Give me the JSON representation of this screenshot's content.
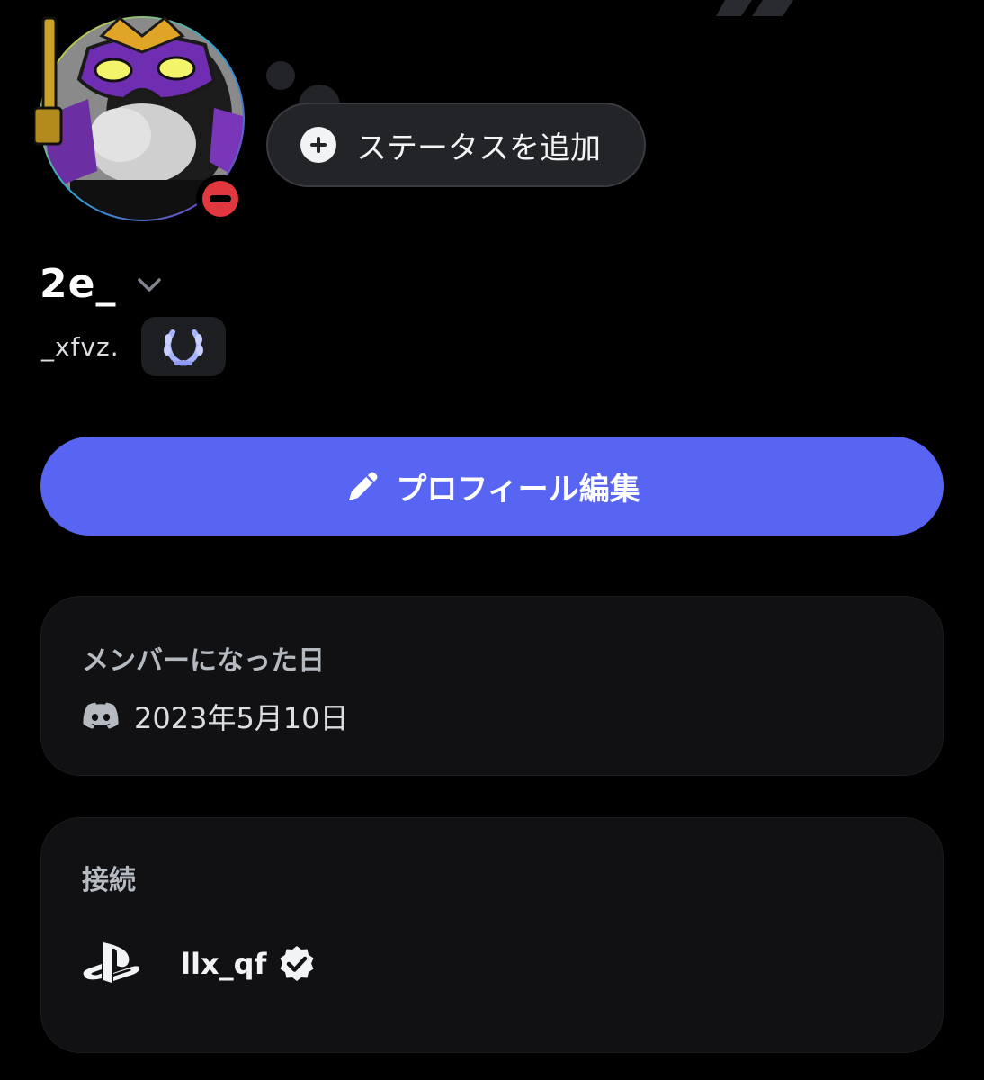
{
  "profile": {
    "display_name": "2e_",
    "username": "_xfvz.",
    "status_button_label": "ステータスを追加",
    "edit_button_label": "プロフィール編集"
  },
  "member_since": {
    "title": "メンバーになった日",
    "date": "2023年5月10日"
  },
  "connections": {
    "title": "接続",
    "items": [
      {
        "service_icon": "playstation-icon",
        "name": "llx_qf",
        "verified": true
      }
    ]
  },
  "colors": {
    "background": "#000000",
    "card": "#111114",
    "accent": "#5865f2",
    "dnd_status": "#e0383e"
  },
  "icons": {
    "status_indicator": "do-not-disturb-icon",
    "add_status": "plus-circle-icon",
    "expand": "chevron-down-icon",
    "badge": "laurel-badge-icon",
    "edit": "pencil-icon",
    "member_since": "discord-logo-icon",
    "verified": "verified-check-icon"
  }
}
